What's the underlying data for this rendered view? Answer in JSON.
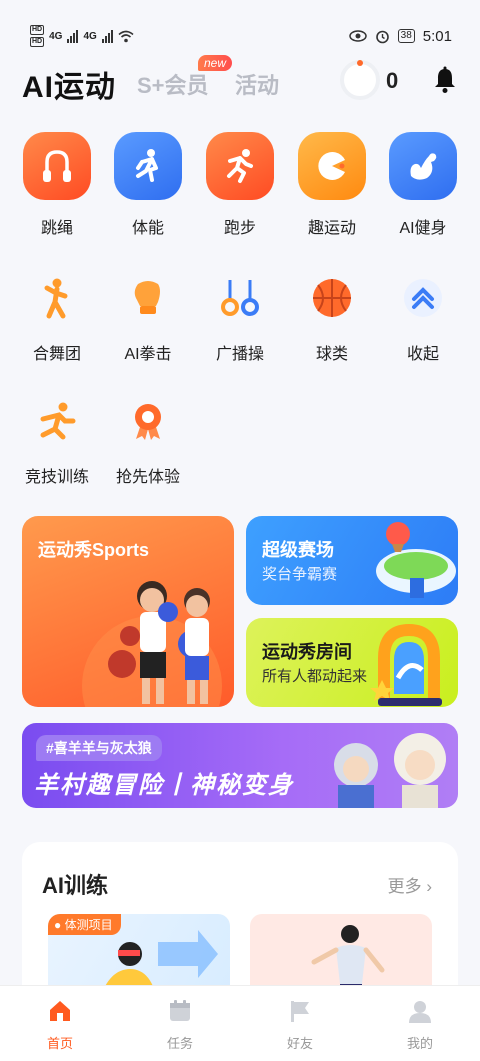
{
  "status_bar": {
    "time": "5:01",
    "battery": "38",
    "network_1": "4G",
    "network_2": "4G"
  },
  "header": {
    "title": "AI运动",
    "tab_vip": "S+会员",
    "tab_activity": "活动",
    "new_badge": "new",
    "ring_count": "0"
  },
  "features": [
    {
      "label": "跳绳",
      "icon": "jump-rope-icon",
      "color": "#ff5a2a"
    },
    {
      "label": "体能",
      "icon": "fitness-runner-icon",
      "color": "#3b7cf6"
    },
    {
      "label": "跑步",
      "icon": "running-icon",
      "color": "#ff5a2a"
    },
    {
      "label": "趣运动",
      "icon": "fun-sport-icon",
      "color": "#ffa21c"
    },
    {
      "label": "AI健身",
      "icon": "muscle-arm-icon",
      "color": "#3b7cf6"
    },
    {
      "label": "合舞团",
      "icon": "dance-icon",
      "color": "#ff9b2b"
    },
    {
      "label": "AI拳击",
      "icon": "boxing-glove-icon",
      "color": "#ff9b2b"
    },
    {
      "label": "广播操",
      "icon": "rings-icon",
      "color": "#3b7cf6"
    },
    {
      "label": "球类",
      "icon": "basketball-icon",
      "color": "#ff5a2a"
    },
    {
      "label": "收起",
      "icon": "collapse-up-icon",
      "color": "#3b7cf6"
    },
    {
      "label": "竞技训练",
      "icon": "skater-icon",
      "color": "#ff9b2b"
    },
    {
      "label": "抢先体验",
      "icon": "medal-icon",
      "color": "#ff6a2b"
    }
  ],
  "cards": {
    "sports_title": "运动秀Sports",
    "super_title": "超级赛场",
    "super_sub": "奖台争霸赛",
    "room_title": "运动秀房间",
    "room_sub": "所有人都动起来"
  },
  "banner": {
    "tag": "#喜羊羊与灰太狼",
    "title": "羊村趣冒险丨神秘变身"
  },
  "training": {
    "title": "AI训练",
    "more": "更多",
    "card1_tag": "体测项目"
  },
  "nav": [
    {
      "label": "首页",
      "icon": "home-icon",
      "active": true
    },
    {
      "label": "任务",
      "icon": "calendar-icon",
      "active": false
    },
    {
      "label": "好友",
      "icon": "flag-icon",
      "active": false
    },
    {
      "label": "我的",
      "icon": "profile-icon",
      "active": false
    }
  ],
  "colors": {
    "accent": "#ff5a1f",
    "blue": "#3b7cf6"
  }
}
